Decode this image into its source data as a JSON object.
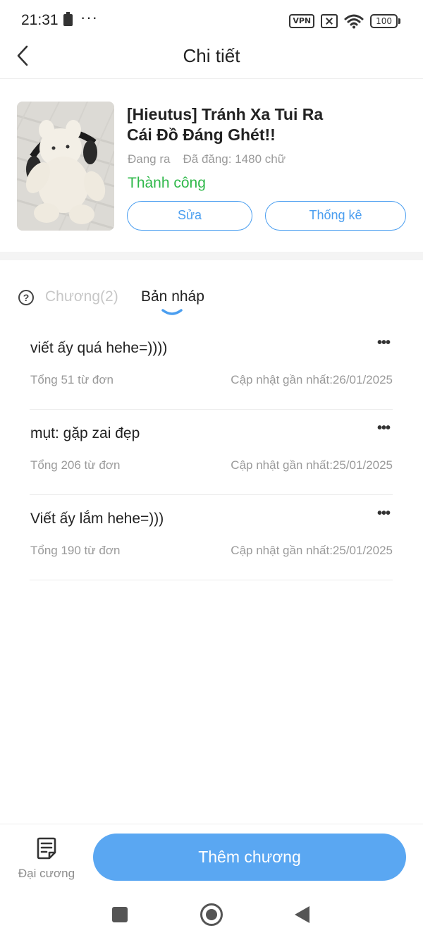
{
  "status_bar": {
    "time": "21:31",
    "dots": "···",
    "vpn": "VPN",
    "battery": "100"
  },
  "header": {
    "title": "Chi tiết",
    "back_icon": "chevron-left-icon"
  },
  "book": {
    "title_line1": "[Hieutus] Tránh Xa Tui Ra",
    "title_line2": "Cái Đồ Đáng Ghét!!",
    "status": "Đang ra",
    "word_count": "Đã đăng: 1480 chữ",
    "review_status": "Thành công",
    "edit_label": "Sửa",
    "stats_label": "Thống kê"
  },
  "tabs": {
    "chapters_label": "Chương(2)",
    "drafts_label": "Bản nháp",
    "active": "drafts"
  },
  "drafts": [
    {
      "title": "viết ấy quá hehe=))))",
      "count": "Tổng 51 từ đơn",
      "updated": "Cập nhật gần nhất:26/01/2025"
    },
    {
      "title": "mụt: gặp zai đẹp",
      "count": "Tổng 206 từ đơn",
      "updated": "Cập nhật gần nhất:25/01/2025"
    },
    {
      "title": "Viết ấy lắm hehe=)))",
      "count": "Tổng 190 từ đơn",
      "updated": "Cập nhật gần nhất:25/01/2025"
    }
  ],
  "bottom": {
    "outline_label": "Đại cương",
    "add_chapter_label": "Thêm chương"
  },
  "colors": {
    "accent": "#5aa7f2",
    "accent_outline": "#4a9ef0",
    "success": "#2fb84a",
    "muted": "#9a9a9a"
  }
}
